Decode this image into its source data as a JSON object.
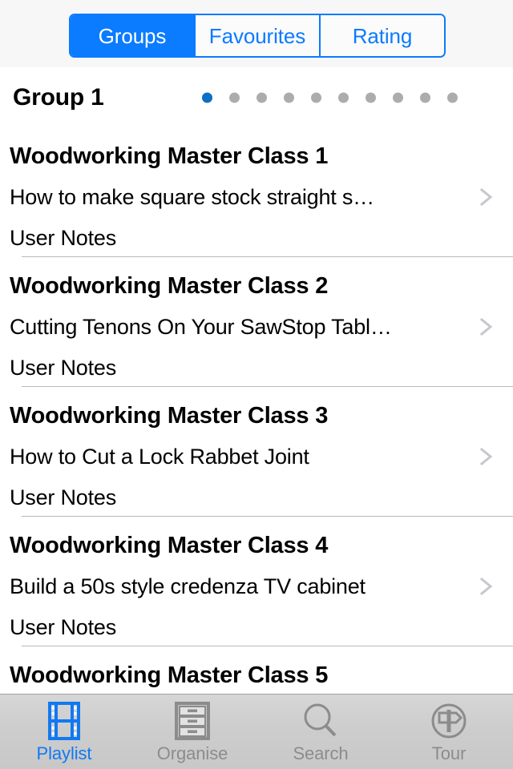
{
  "colors": {
    "accent_blue": "#0b7bff",
    "tab_active_blue": "#1079f2",
    "dot_active_blue": "#0b6fc4",
    "dot_inactive_gray": "#acacac",
    "tab_inactive_gray": "#8c8c8c",
    "topbar_bg": "#f7f7f7",
    "separator": "#b9b9b9"
  },
  "segmented_control": {
    "selected_index": 0,
    "segments": [
      {
        "label": "Groups",
        "selected": true
      },
      {
        "label": "Favourites",
        "selected": false
      },
      {
        "label": "Rating",
        "selected": false
      }
    ]
  },
  "group_header": {
    "title": "Group 1",
    "pager": {
      "total": 10,
      "current_index": 0
    }
  },
  "list": {
    "notes_label": "User Notes",
    "disclosure_icon": "chevron-right-icon",
    "rows": [
      {
        "title": "Woodworking Master Class 1",
        "subtitle": "How to make square stock straight s…",
        "notes": "User Notes"
      },
      {
        "title": "Woodworking Master Class 2",
        "subtitle": "Cutting Tenons On Your SawStop Tabl…",
        "notes": "User Notes"
      },
      {
        "title": "Woodworking Master Class 3",
        "subtitle": "How to Cut a Lock Rabbet Joint",
        "notes": "User Notes"
      },
      {
        "title": "Woodworking Master Class 4",
        "subtitle": "Build a 50s style credenza  TV cabinet",
        "notes": "User Notes"
      },
      {
        "title": "Woodworking Master Class 5",
        "subtitle": "",
        "notes": ""
      }
    ]
  },
  "tabbar": {
    "active_index": 0,
    "tabs": [
      {
        "label": "Playlist",
        "icon": "film-strip-icon",
        "active": true
      },
      {
        "label": "Organise",
        "icon": "filing-cabinet-icon",
        "active": false
      },
      {
        "label": "Search",
        "icon": "magnifier-icon",
        "active": false
      },
      {
        "label": "Tour",
        "icon": "signpost-circle-icon",
        "active": false
      }
    ]
  }
}
